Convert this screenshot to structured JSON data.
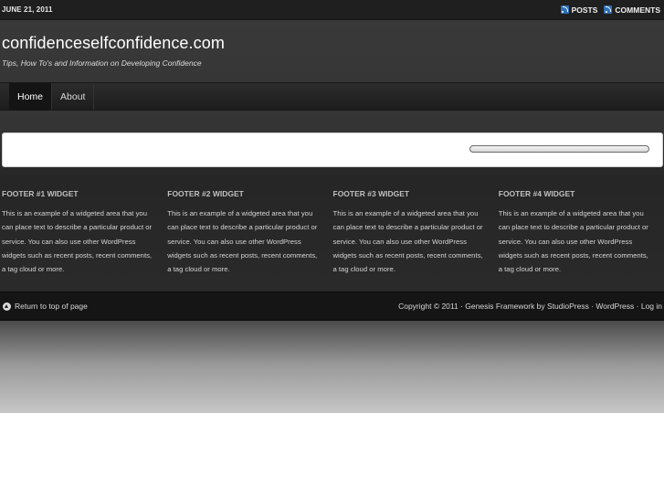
{
  "topbar": {
    "date": "JUNE 21, 2011",
    "feeds": [
      {
        "label": "POSTS",
        "icon": "rss-icon"
      },
      {
        "label": "COMMENTS",
        "icon": "rss-icon"
      }
    ]
  },
  "header": {
    "title": "confidenceselfconfidence.com",
    "description": "Tips, How To's and Information on Developing Confidence"
  },
  "nav": {
    "items": [
      {
        "label": "Home",
        "active": true
      },
      {
        "label": "About",
        "active": false
      }
    ]
  },
  "search": {
    "value": ""
  },
  "widgets": [
    {
      "title": "FOOTER #1 WIDGET",
      "text": "This is an example of a widgeted area that you can place text to describe a particular product or service. You can also use other WordPress widgets such as recent posts, recent comments, a tag cloud or more."
    },
    {
      "title": "FOOTER #2 WIDGET",
      "text": "This is an example of a widgeted area that you can place text to describe a particular product or service. You can also use other WordPress widgets such as recent posts, recent comments, a tag cloud or more."
    },
    {
      "title": "FOOTER #3 WIDGET",
      "text": "This is an example of a widgeted area that you can place text to describe a particular product or service. You can also use other WordPress widgets such as recent posts, recent comments, a tag cloud or more."
    },
    {
      "title": "FOOTER #4 WIDGET",
      "text": "This is an example of a widgeted area that you can place text to describe a particular product or service. You can also use other WordPress widgets such as recent posts, recent comments, a tag cloud or more."
    }
  ],
  "footer": {
    "back_to_top": "Return to top of page",
    "copyright": "Copyright © 2011 · Genesis Framework by StudioPress · WordPress · Log in"
  },
  "colors": {
    "rss": "#2f6fb7",
    "nav_active": "#141414",
    "footer_bg": "#151515"
  }
}
